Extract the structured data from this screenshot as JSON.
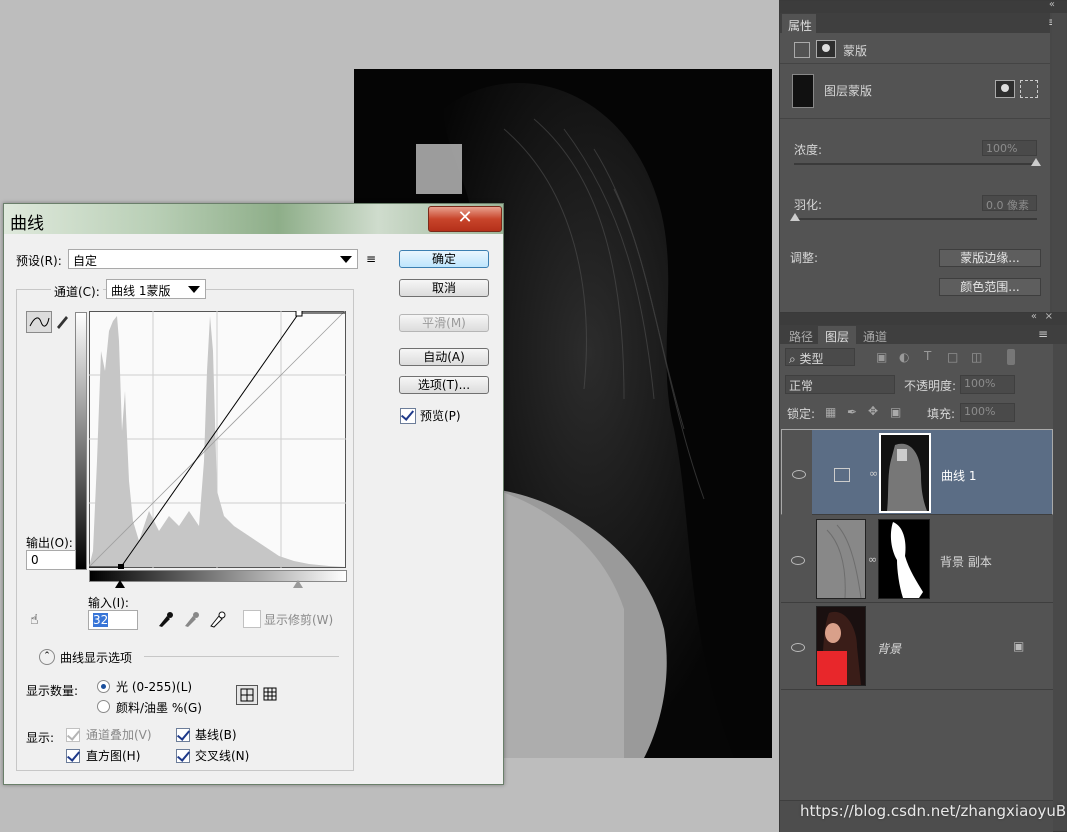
{
  "dialog": {
    "title": "曲线",
    "close_glyph": "✕",
    "preset_label": "预设(R):",
    "preset_value": "自定",
    "channel_label": "通道(C):",
    "channel_value": "曲线 1蒙版",
    "output_label": "输出(O):",
    "output_value": "0",
    "input_label": "输入(I):",
    "input_value": "32",
    "show_clipping_label": "显示修剪(W)",
    "buttons": {
      "ok": "确定",
      "cancel": "取消",
      "smooth": "平滑(M)",
      "auto": "自动(A)",
      "options": "选项(T)...",
      "preview": "预览(P)"
    },
    "curve_display_options_label": "曲线显示选项",
    "show_amount_label": "显示数量:",
    "light_label": "光 (0-255)(L)",
    "pigment_label": "颜料/油墨 %(G)",
    "show_label": "显示:",
    "channel_overlay_label": "通道叠加(V)",
    "baseline_label": "基线(B)",
    "histogram_label": "直方图(H)",
    "intersection_label": "交叉线(N)"
  },
  "properties_panel": {
    "tab": "属性",
    "mask_title": "蒙版",
    "layer_mask_label": "图层蒙版",
    "density_label": "浓度:",
    "density_value": "100%",
    "feather_label": "羽化:",
    "feather_value": "0.0 像素",
    "adjust_label": "调整:",
    "mask_edge_button": "蒙版边缘...",
    "color_range_button": "颜色范围..."
  },
  "layers_panel": {
    "tabs": [
      "路径",
      "图层",
      "通道"
    ],
    "filter_kind": "类型",
    "blend_mode": "正常",
    "opacity_label": "不透明度:",
    "opacity_value": "100%",
    "lock_label": "锁定:",
    "fill_label": "填充:",
    "fill_value": "100%",
    "layers": [
      {
        "name": "曲线 1"
      },
      {
        "name": "背景 副本"
      },
      {
        "name": "背景"
      }
    ]
  },
  "watermark": "https://blog.csdn.net/zhangxiaoyuBK",
  "colors": {
    "panel_bg": "#535353",
    "selected_layer": "#5b6d85",
    "close_button": "#c8452b"
  }
}
